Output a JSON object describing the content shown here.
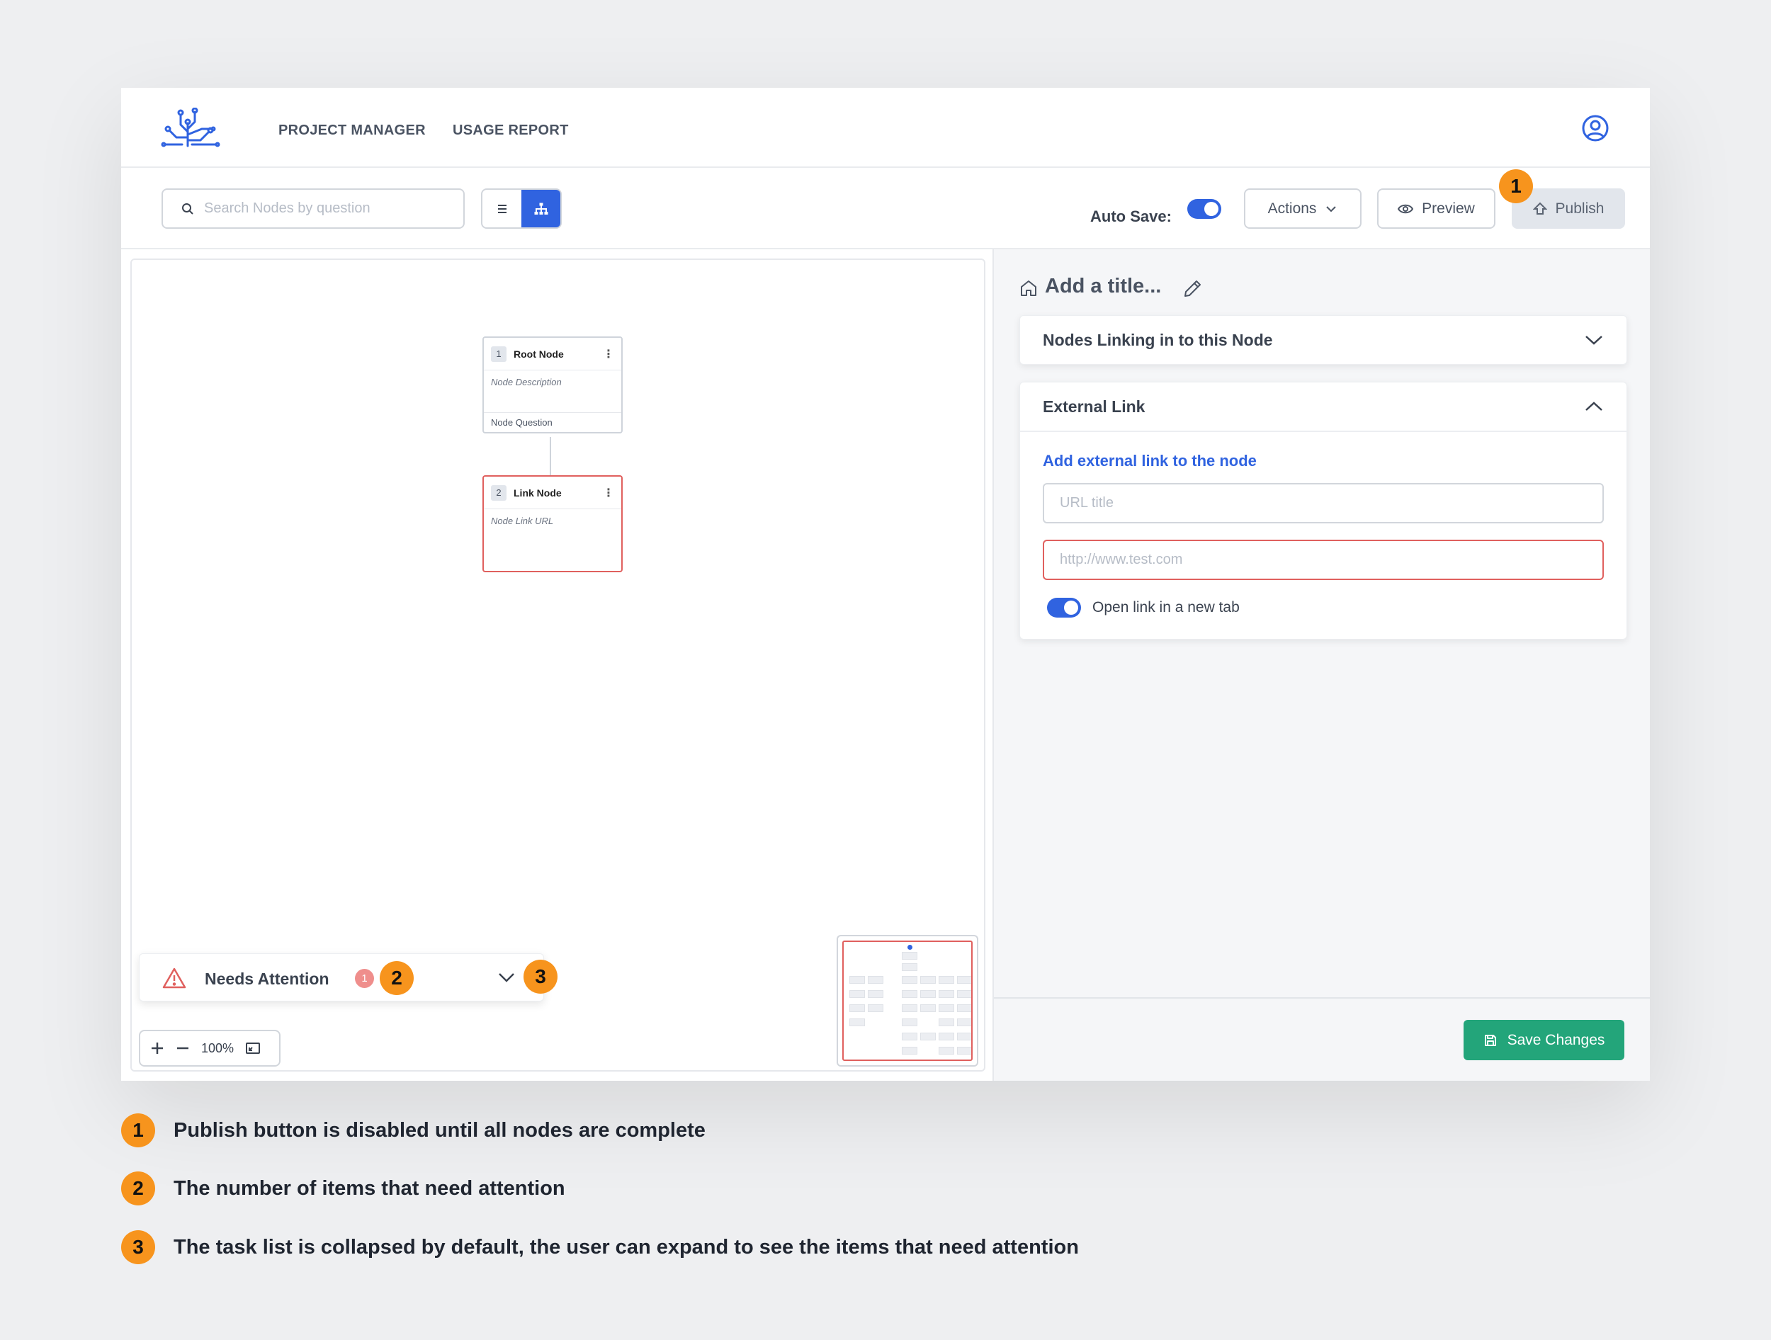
{
  "header": {
    "nav": [
      "PROJECT MANAGER",
      "USAGE REPORT"
    ]
  },
  "toolbar": {
    "search_placeholder": "Search Nodes by question",
    "autosave_label": "Auto Save:",
    "actions_label": "Actions",
    "preview_label": "Preview",
    "publish_label": "Publish"
  },
  "canvas": {
    "nodes": [
      {
        "number": "1",
        "title": "Root Node",
        "description": "Node Description",
        "footer": "Node Question"
      },
      {
        "number": "2",
        "title": "Link Node",
        "description": "Node Link URL"
      }
    ],
    "attention_label": "Needs Attention",
    "attention_count": "1",
    "zoom_level": "100%"
  },
  "panel": {
    "title": "Add a title...",
    "sections": [
      {
        "title": "Nodes Linking in to this Node",
        "expanded": false
      },
      {
        "title": "External Link",
        "expanded": true
      }
    ],
    "link_heading": "Add external link to the node",
    "url_title_placeholder": "URL title",
    "url_placeholder": "http://www.test.com",
    "new_tab_label": "Open link in a new tab",
    "save_label": "Save Changes"
  },
  "callouts": {
    "markers": [
      "1",
      "2",
      "3"
    ],
    "notes": [
      {
        "number": "1",
        "text": "Publish button is disabled until all nodes are complete"
      },
      {
        "number": "2",
        "text": "The number of items that need attention"
      },
      {
        "number": "3",
        "text": "The task list is collapsed by default, the user can expand to see the items that need attention"
      }
    ]
  },
  "colors": {
    "accent": "#3063e0",
    "success": "#23a57a",
    "error": "#e0605e",
    "callout": "#f7941d"
  }
}
